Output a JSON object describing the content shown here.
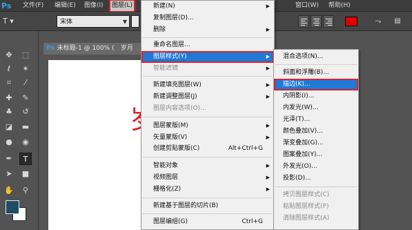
{
  "app": {
    "logo": "Ps"
  },
  "menubar": {
    "items": [
      "文件(F)",
      "编辑(E)",
      "图像(I)",
      "图层(L)",
      "窗口(W)",
      "帮助(H)"
    ]
  },
  "options": {
    "tool_preset": "T ▾",
    "font_family": "宋体",
    "text_color": "#e10000"
  },
  "document": {
    "tab_title": "未标题-1 @ 100% (",
    "tab_tail": "岁月",
    "canvas_text": "岁",
    "canvas_text_color": "#e0202a"
  },
  "toolbar": {
    "foreground_color": "#1f4f67",
    "background_color": "#ffffff"
  },
  "layer_menu": {
    "items": [
      {
        "label": "新建(N)",
        "shortcut": "",
        "submenu": true,
        "disabled": false
      },
      {
        "label": "复制图层(D)...",
        "shortcut": "",
        "submenu": false,
        "disabled": false
      },
      {
        "label": "删除",
        "shortcut": "",
        "submenu": true,
        "disabled": false
      },
      {
        "label": "重命名图层...",
        "shortcut": "",
        "submenu": false,
        "disabled": false
      },
      {
        "label": "图层样式(Y)",
        "shortcut": "",
        "submenu": true,
        "disabled": false
      },
      {
        "label": "智能滤镜",
        "shortcut": "",
        "submenu": true,
        "disabled": true
      },
      {
        "label": "新建填充图层(W)",
        "shortcut": "",
        "submenu": true,
        "disabled": false
      },
      {
        "label": "新建调整图层(J)",
        "shortcut": "",
        "submenu": true,
        "disabled": false
      },
      {
        "label": "图层内容选项(O)...",
        "shortcut": "",
        "submenu": false,
        "disabled": true
      },
      {
        "label": "图层蒙版(M)",
        "shortcut": "",
        "submenu": true,
        "disabled": false
      },
      {
        "label": "矢量蒙版(V)",
        "shortcut": "",
        "submenu": true,
        "disabled": false
      },
      {
        "label": "创建剪贴蒙版(C)",
        "shortcut": "Alt+Ctrl+G",
        "submenu": false,
        "disabled": false
      },
      {
        "label": "智能对象",
        "shortcut": "",
        "submenu": true,
        "disabled": false
      },
      {
        "label": "视频图层",
        "shortcut": "",
        "submenu": true,
        "disabled": false
      },
      {
        "label": "栅格化(Z)",
        "shortcut": "",
        "submenu": true,
        "disabled": false
      },
      {
        "label": "新建基于图层的切片(B)",
        "shortcut": "",
        "submenu": false,
        "disabled": false
      },
      {
        "label": "图层编组(G)",
        "shortcut": "Ctrl+G",
        "submenu": false,
        "disabled": false
      }
    ]
  },
  "style_menu": {
    "items": [
      {
        "label": "混合选项(N)...",
        "disabled": false
      },
      {
        "label": "斜面和浮雕(B)...",
        "disabled": false
      },
      {
        "label": "描边(K)...",
        "disabled": false
      },
      {
        "label": "内阴影(I)...",
        "disabled": false
      },
      {
        "label": "内发光(W)...",
        "disabled": false
      },
      {
        "label": "光泽(T)...",
        "disabled": false
      },
      {
        "label": "颜色叠加(V)...",
        "disabled": false
      },
      {
        "label": "渐变叠加(G)...",
        "disabled": false
      },
      {
        "label": "图案叠加(Y)...",
        "disabled": false
      },
      {
        "label": "外发光(O)...",
        "disabled": false
      },
      {
        "label": "投影(D)...",
        "disabled": false
      },
      {
        "label": "拷贝图层样式(C)",
        "disabled": true
      },
      {
        "label": "粘贴图层样式(P)",
        "disabled": true
      },
      {
        "label": "清除图层样式(A)",
        "disabled": true
      }
    ]
  }
}
